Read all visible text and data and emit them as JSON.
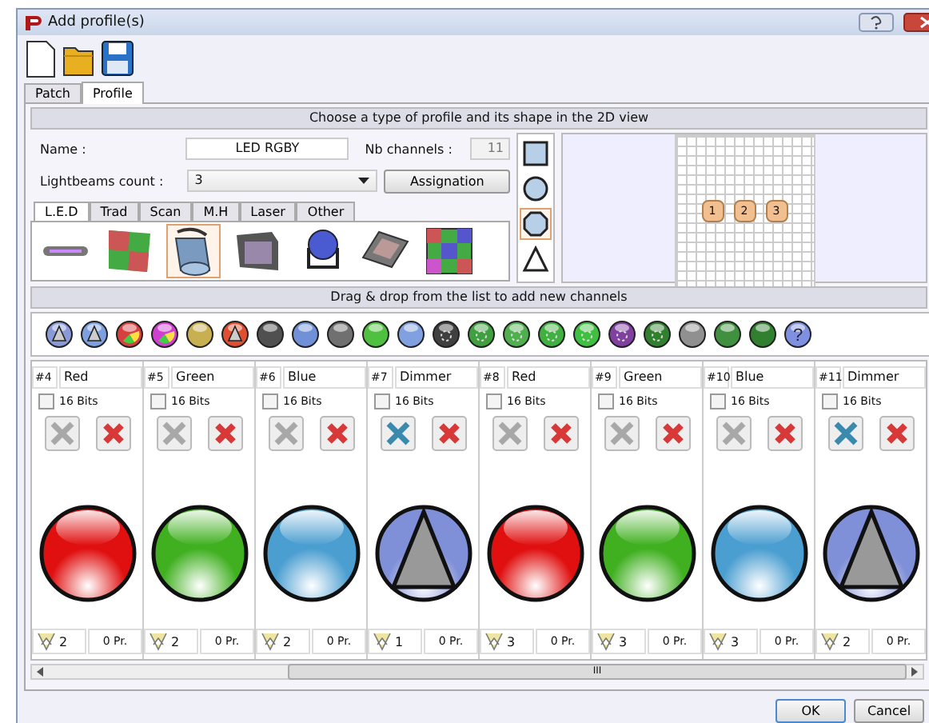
{
  "window": {
    "title": "Add profile(s)"
  },
  "toolbar": [
    {
      "kind": "new"
    },
    {
      "kind": "open"
    },
    {
      "kind": "save"
    }
  ],
  "tabs": [
    {
      "label": "Patch",
      "selected": false
    },
    {
      "label": "Profile",
      "selected": true
    }
  ],
  "profile": {
    "header": "Choose a type of profile and its shape in the 2D view",
    "name_label": "Name :",
    "name_value": "LED RGBY",
    "channels_label": "Nb channels :",
    "channels_value": "11",
    "beams_label": "Lightbeams count :",
    "beams_value": "3",
    "assign_button": "Assignation",
    "categories": [
      {
        "label": "L.E.D",
        "selected": true
      },
      {
        "label": "Trad",
        "selected": false
      },
      {
        "label": "Scan",
        "selected": false
      },
      {
        "label": "M.H",
        "selected": false
      },
      {
        "label": "Laser",
        "selected": false
      },
      {
        "label": "Other",
        "selected": false
      }
    ],
    "fixtures": [
      {
        "kind": "bar",
        "selected": false
      },
      {
        "kind": "panel",
        "selected": false
      },
      {
        "kind": "can",
        "selected": true
      },
      {
        "kind": "flood",
        "selected": false
      },
      {
        "kind": "par",
        "selected": false
      },
      {
        "kind": "matrix",
        "selected": false
      },
      {
        "kind": "pixel",
        "selected": false
      }
    ],
    "shapes": [
      {
        "kind": "square",
        "selected": false
      },
      {
        "kind": "circle",
        "selected": false
      },
      {
        "kind": "octagon",
        "selected": true
      },
      {
        "kind": "triangle",
        "selected": false
      }
    ],
    "preview_beams": [
      "1",
      "2",
      "3"
    ]
  },
  "channels_header": "Drag & drop from the list to add new channels",
  "palette": [
    {
      "kind": "triangle",
      "color": "#8a9ad8"
    },
    {
      "kind": "triangle",
      "color": "#7fa0e0"
    },
    {
      "kind": "wheel",
      "color": "#d84040"
    },
    {
      "kind": "wheel",
      "color": "#d040d0"
    },
    {
      "kind": "plain",
      "color": "#c8b050"
    },
    {
      "kind": "triangle",
      "color": "#e05030"
    },
    {
      "kind": "plain",
      "color": "#505050"
    },
    {
      "kind": "plain",
      "color": "#7090d8"
    },
    {
      "kind": "plain",
      "color": "#707070"
    },
    {
      "kind": "plain",
      "color": "#50c040"
    },
    {
      "kind": "plain",
      "color": "#80a0e0"
    },
    {
      "kind": "gobo",
      "color": "#404040"
    },
    {
      "kind": "gobo",
      "color": "#40a040"
    },
    {
      "kind": "gobo",
      "color": "#50b050"
    },
    {
      "kind": "gobo",
      "color": "#40b040"
    },
    {
      "kind": "gobo",
      "color": "#40c040"
    },
    {
      "kind": "gobo",
      "color": "#8040a0"
    },
    {
      "kind": "gobo",
      "color": "#308030"
    },
    {
      "kind": "plain",
      "color": "#909090"
    },
    {
      "kind": "plain",
      "color": "#409040"
    },
    {
      "kind": "plain",
      "color": "#308030"
    },
    {
      "kind": "help",
      "color": "#8090e0",
      "glyph": "?"
    }
  ],
  "channels": [
    {
      "number": "#4",
      "name": "Red",
      "bits_label": "16 Bits",
      "bits16": false,
      "kind": "color",
      "color": "#e01010",
      "settings_enabled": false,
      "beams": "2",
      "presets": "0 Pr."
    },
    {
      "number": "#5",
      "name": "Green",
      "bits_label": "16 Bits",
      "bits16": false,
      "kind": "color",
      "color": "#40b020",
      "settings_enabled": false,
      "beams": "2",
      "presets": "0 Pr."
    },
    {
      "number": "#6",
      "name": "Blue",
      "bits_label": "16 Bits",
      "bits16": false,
      "kind": "color",
      "color": "#4a9ed0",
      "settings_enabled": false,
      "beams": "2",
      "presets": "0 Pr."
    },
    {
      "number": "#7",
      "name": "Dimmer",
      "bits_label": "16 Bits",
      "bits16": false,
      "kind": "dimmer",
      "color": "#7f8fd8",
      "settings_enabled": true,
      "beams": "1",
      "presets": "0 Pr."
    },
    {
      "number": "#8",
      "name": "Red",
      "bits_label": "16 Bits",
      "bits16": false,
      "kind": "color",
      "color": "#e01010",
      "settings_enabled": false,
      "beams": "3",
      "presets": "0 Pr."
    },
    {
      "number": "#9",
      "name": "Green",
      "bits_label": "16 Bits",
      "bits16": false,
      "kind": "color",
      "color": "#40b020",
      "settings_enabled": false,
      "beams": "3",
      "presets": "0 Pr."
    },
    {
      "number": "#10",
      "name": "Blue",
      "bits_label": "16 Bits",
      "bits16": false,
      "kind": "color",
      "color": "#4a9ed0",
      "settings_enabled": false,
      "beams": "3",
      "presets": "0 Pr."
    },
    {
      "number": "#11",
      "name": "Dimmer",
      "bits_label": "16 Bits",
      "bits16": false,
      "kind": "dimmer",
      "color": "#7f8fd8",
      "settings_enabled": true,
      "beams": "2",
      "presets": "0 Pr."
    }
  ],
  "scrollbar_grip": "III",
  "buttons": [
    "OK",
    "Cancel"
  ]
}
